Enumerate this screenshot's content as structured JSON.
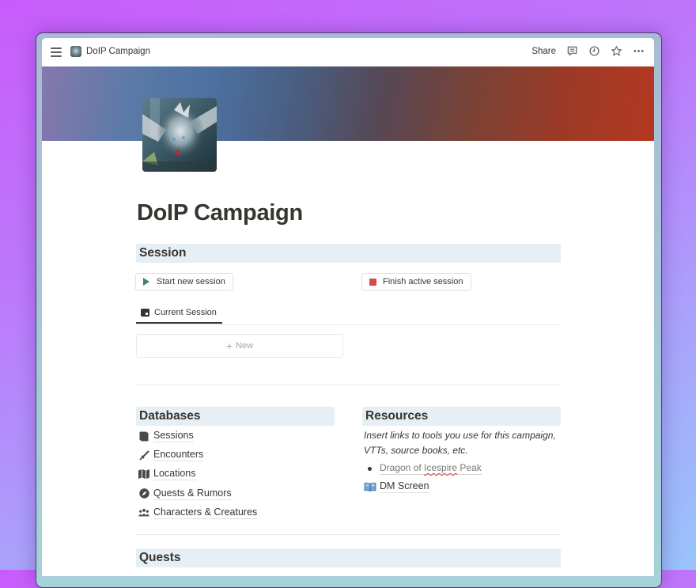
{
  "window": {
    "breadcrumb_title": "DoIP Campaign",
    "actions": {
      "share_label": "Share",
      "icons": [
        "comment-icon",
        "clock-history-icon",
        "star-icon",
        "more-icon"
      ]
    }
  },
  "page": {
    "title": "DoIP Campaign",
    "cover_colors": [
      "#8678ad",
      "#4c70a0",
      "#564856",
      "#b43821"
    ],
    "icon": "dragon-image"
  },
  "session": {
    "heading": "Session",
    "start_button": "Start new session",
    "finish_button": "Finish active session",
    "tab_label": "Current Session",
    "new_label": "New"
  },
  "databases": {
    "heading": "Databases",
    "items": [
      {
        "icon": "book-icon",
        "label": "Sessions"
      },
      {
        "icon": "sword-icon",
        "label": "Encounters"
      },
      {
        "icon": "map-icon",
        "label": "Locations"
      },
      {
        "icon": "compass-icon",
        "label": "Quests & Rumors"
      },
      {
        "icon": "people-icon",
        "label": "Characters & Creatures"
      }
    ]
  },
  "resources": {
    "heading": "Resources",
    "description": "Insert links to tools you use for this campaign, VTTs, source books, etc.",
    "links": [
      {
        "prefix": "Dragon of ",
        "misspelled": "Icespire",
        "suffix": " Peak"
      }
    ],
    "dm_screen": {
      "emoji": "📖",
      "label": "DM Screen"
    }
  },
  "quests": {
    "heading": "Quests"
  },
  "colors": {
    "heading_bg": "#e5eff5",
    "text": "#37352f",
    "play": "#448361",
    "stop": "#d44c47"
  }
}
